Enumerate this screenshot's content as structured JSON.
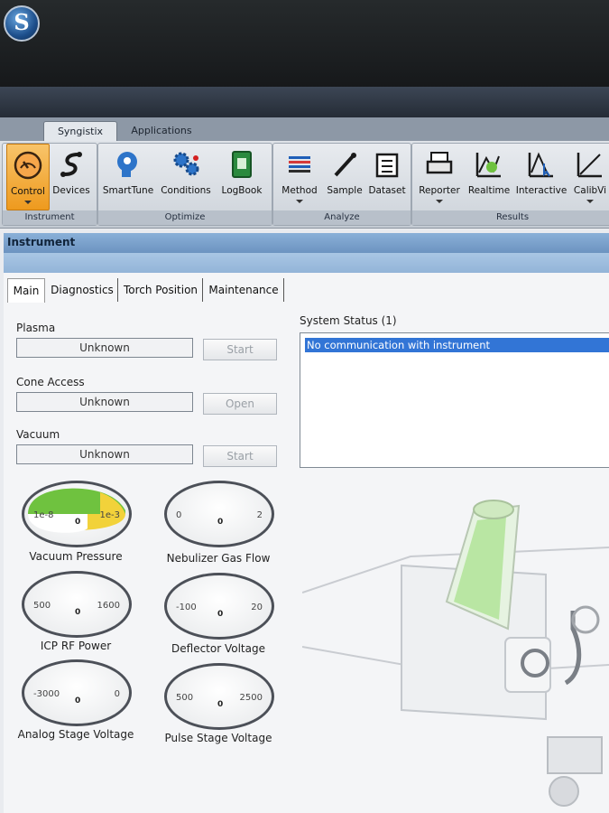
{
  "ribbon_tabs": [
    "Syngistix",
    "Applications"
  ],
  "ribbon_groups": [
    {
      "label": "Instrument",
      "buttons": [
        {
          "label": "Control",
          "icon": "gauge-icon"
        },
        {
          "label": "Devices",
          "icon": "devices-icon"
        }
      ]
    },
    {
      "label": "Optimize",
      "buttons": [
        {
          "label": "SmartTune",
          "icon": "smarttune-icon"
        },
        {
          "label": "Conditions",
          "icon": "gears-icon"
        },
        {
          "label": "LogBook",
          "icon": "logbook-icon"
        }
      ]
    },
    {
      "label": "Analyze",
      "buttons": [
        {
          "label": "Method",
          "icon": "method-icon"
        },
        {
          "label": "Sample",
          "icon": "pipette-icon"
        },
        {
          "label": "Dataset",
          "icon": "dataset-icon"
        }
      ]
    },
    {
      "label": "Results",
      "buttons": [
        {
          "label": "Reporter",
          "icon": "printer-icon"
        },
        {
          "label": "Realtime",
          "icon": "realtime-icon"
        },
        {
          "label": "Interactive",
          "icon": "interactive-icon"
        },
        {
          "label": "CalibVi",
          "icon": "calib-icon"
        }
      ]
    }
  ],
  "panel_title": "Instrument",
  "tabs": [
    "Main",
    "Diagnostics",
    "Torch Position",
    "Maintenance"
  ],
  "fields": [
    {
      "label": "Plasma",
      "value": "Unknown",
      "button": "Start"
    },
    {
      "label": "Cone Access",
      "value": "Unknown",
      "button": "Open"
    },
    {
      "label": "Vacuum",
      "value": "Unknown",
      "button": "Start"
    }
  ],
  "system_status": {
    "label": "System Status (1)",
    "messages": [
      "No communication with instrument"
    ]
  },
  "gauges": [
    {
      "label": "Vacuum Pressure",
      "min": "1e-8",
      "max": "1e-3",
      "value": "0"
    },
    {
      "label": "Nebulizer Gas Flow",
      "min": "0",
      "max": "2",
      "value": "0"
    },
    {
      "label": "ICP RF Power",
      "min": "500",
      "max": "1600",
      "value": "0"
    },
    {
      "label": "Deflector Voltage",
      "min": "-100",
      "max": "20",
      "value": "0"
    },
    {
      "label": "Analog Stage Voltage",
      "min": "-3000",
      "max": "0",
      "value": "0"
    },
    {
      "label": "Pulse Stage Voltage",
      "min": "500",
      "max": "2500",
      "value": "0"
    }
  ],
  "colors": {
    "gauge_green": "#6fc23f",
    "gauge_yellow": "#f2d23a",
    "selection_blue": "#3275d6",
    "control_highlight": "#ee9a1e"
  }
}
